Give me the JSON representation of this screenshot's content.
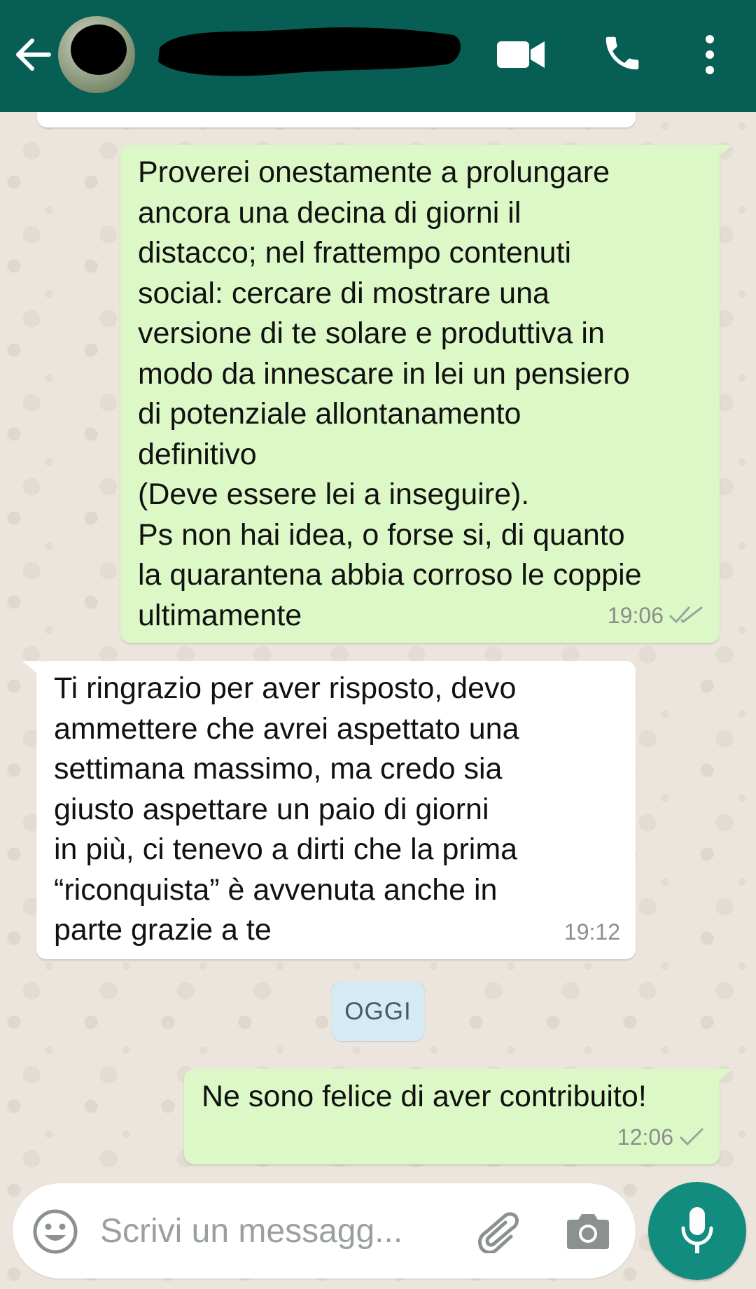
{
  "header": {
    "back_icon": "arrow-left-icon",
    "contact_name_redacted": true,
    "actions": [
      "video-camera-icon",
      "phone-icon",
      "more-vert-icon"
    ],
    "color": "#075e54"
  },
  "messages": [
    {
      "direction": "outgoing",
      "text": "Proverei onestamente a prolungare\nancora una decina di giorni il\ndistacco; nel frattempo contenuti\nsocial: cercare di mostrare una\nversione di te solare e produttiva in\nmodo da innescare in lei un pensiero\ndi potenziale allontanamento\ndefinitivo\n(Deve essere lei a inseguire).\nPs non hai idea, o forse si, di quanto\nla quarantena abbia corroso le coppie\nultimamente",
      "time": "19:06",
      "status": "read"
    },
    {
      "direction": "incoming",
      "text": "Ti ringrazio per aver risposto, devo\nammettere che avrei aspettato una\nsettimana massimo, ma credo sia\ngiusto aspettare un paio di giorni\nin più, ci tenevo a dirti che la prima\n“riconquista” è avvenuta anche in\nparte grazie a te",
      "time": "19:12"
    },
    {
      "direction": "outgoing",
      "text": "Ne sono felice di aver contribuito!",
      "time": "12:06",
      "status": "sent"
    }
  ],
  "date_separator": "OGGI",
  "composer": {
    "placeholder": "Scrivi un messagg...",
    "emoji_icon": "emoji-icon",
    "attach_icon": "paperclip-icon",
    "camera_icon": "camera-icon",
    "mic_icon": "microphone-icon"
  },
  "colors": {
    "outgoing_bubble": "#dcf8c6",
    "incoming_bubble": "#ffffff",
    "mic_button": "#128c7e",
    "date_chip": "#d4eaf4",
    "read_ticks": "#9aa59a"
  }
}
